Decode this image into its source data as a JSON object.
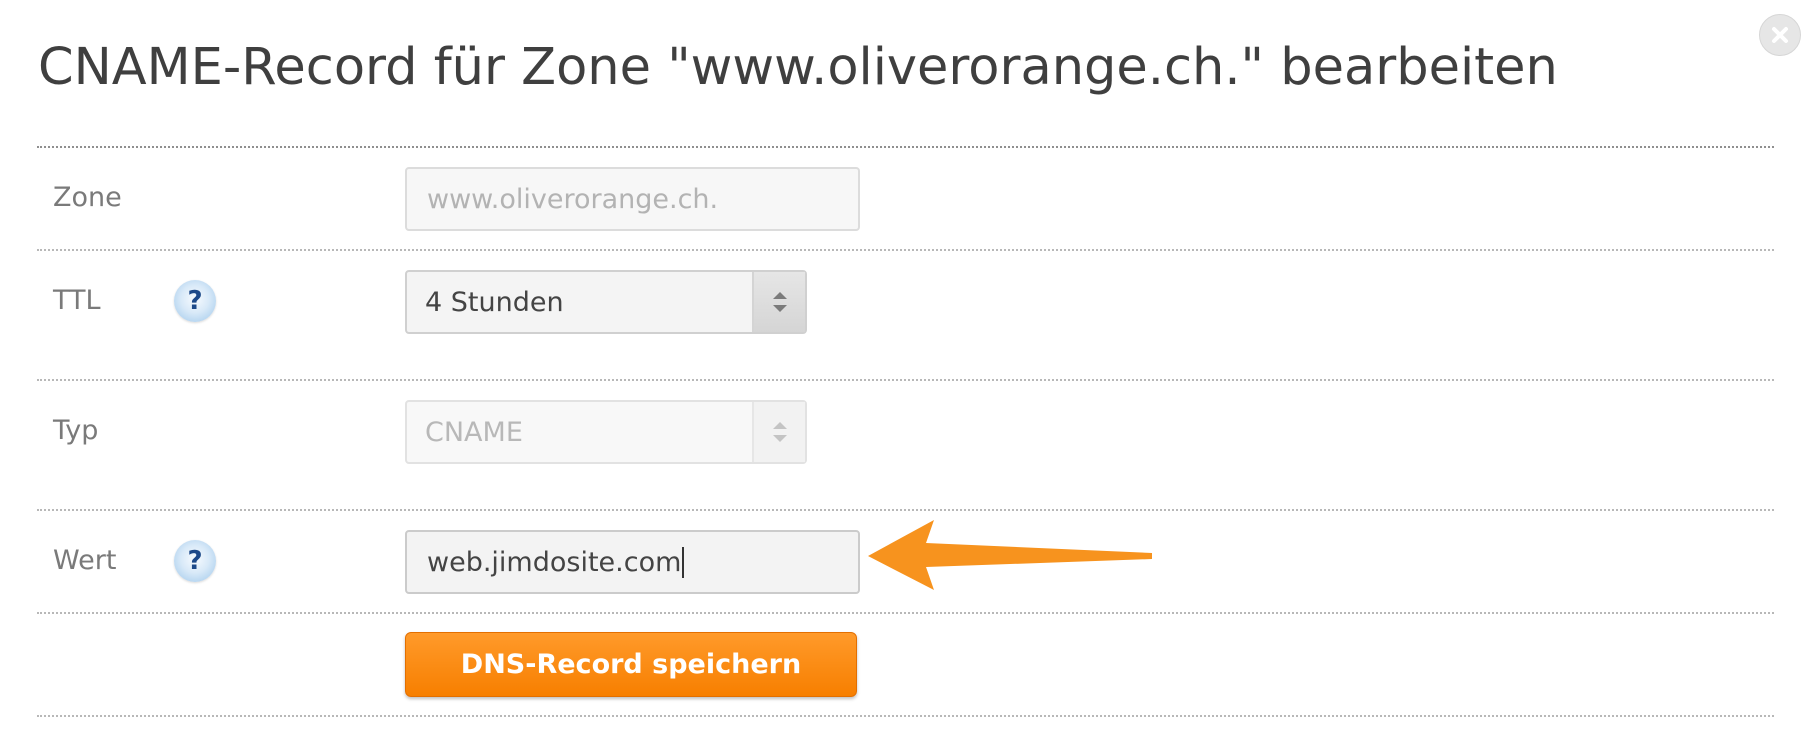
{
  "dialog": {
    "title": "CNAME-Record für Zone \"www.oliverorange.ch.\" bearbeiten",
    "close_icon": "close-icon"
  },
  "form": {
    "zone": {
      "label": "Zone",
      "value": "www.oliverorange.ch.",
      "disabled": true
    },
    "ttl": {
      "label": "TTL",
      "help": "?",
      "selected": "4 Stunden"
    },
    "typ": {
      "label": "Typ",
      "selected": "CNAME",
      "disabled": true
    },
    "wert": {
      "label": "Wert",
      "help": "?",
      "value": "web.jimdosite.com"
    },
    "save_label": "DNS-Record speichern"
  },
  "annotation": {
    "arrow_color": "#f7931e",
    "arrow_icon": "arrow-left-icon"
  },
  "colors": {
    "accent": "#f7931e",
    "button": "#f88a0f",
    "help_icon": "#1d4a8a"
  }
}
